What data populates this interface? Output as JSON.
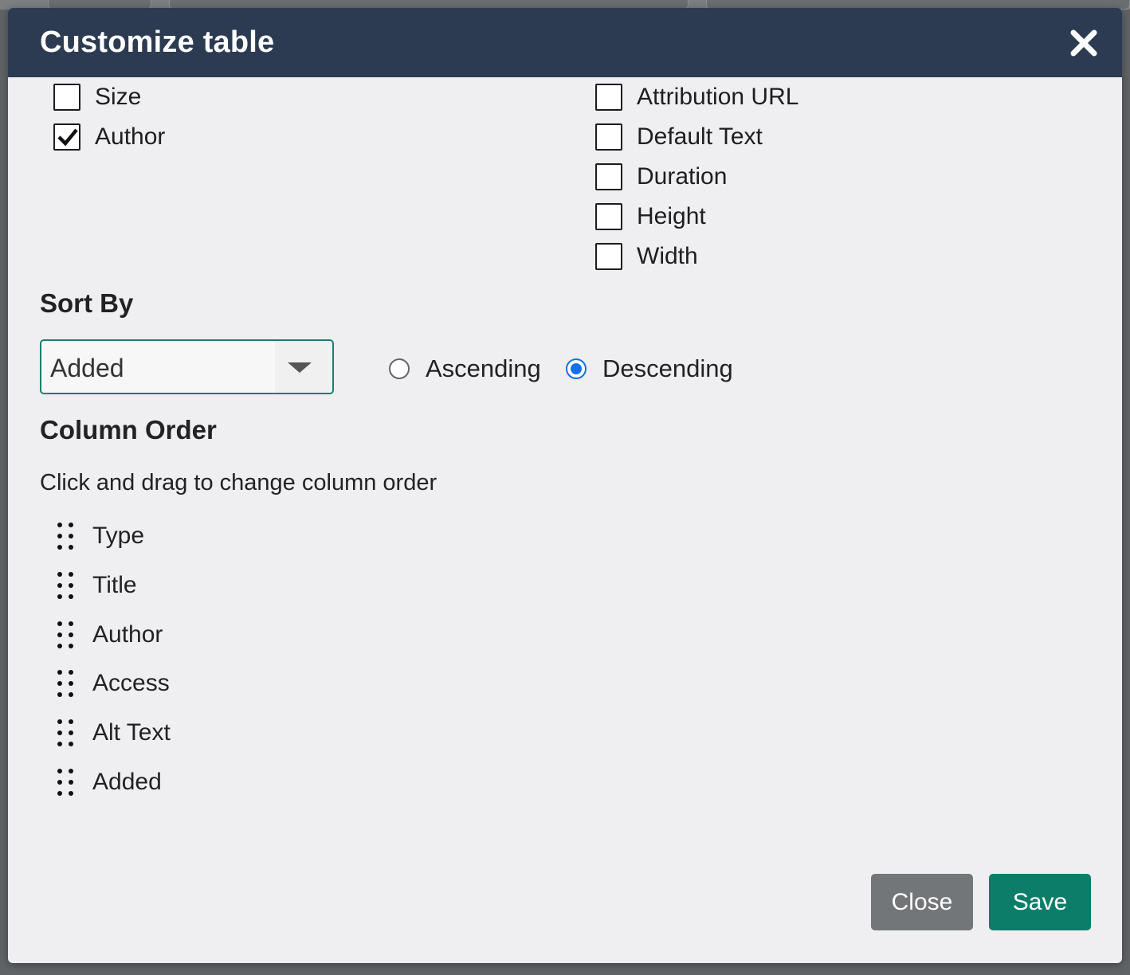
{
  "modal": {
    "title": "Customize table",
    "close_icon": "close-x-icon"
  },
  "columns_left": [
    {
      "label": "Size",
      "checked": false
    },
    {
      "label": "Author",
      "checked": true
    }
  ],
  "columns_right": [
    {
      "label": "Attribution URL",
      "checked": false
    },
    {
      "label": "Default Text",
      "checked": false
    },
    {
      "label": "Duration",
      "checked": false
    },
    {
      "label": "Height",
      "checked": false
    },
    {
      "label": "Width",
      "checked": false
    }
  ],
  "sort": {
    "title": "Sort By",
    "selected": "Added",
    "ascending_label": "Ascending",
    "descending_label": "Descending",
    "direction": "descending",
    "accent": "#1670e6"
  },
  "column_order": {
    "title": "Column Order",
    "hint": "Click and drag to change column order",
    "items": [
      "Type",
      "Title",
      "Author",
      "Access",
      "Alt Text",
      "Added"
    ]
  },
  "footer": {
    "close_label": "Close",
    "save_label": "Save",
    "save_color": "#0b7d68"
  },
  "colors": {
    "header": "#2c3b51",
    "select_border": "#1b7f6f"
  }
}
